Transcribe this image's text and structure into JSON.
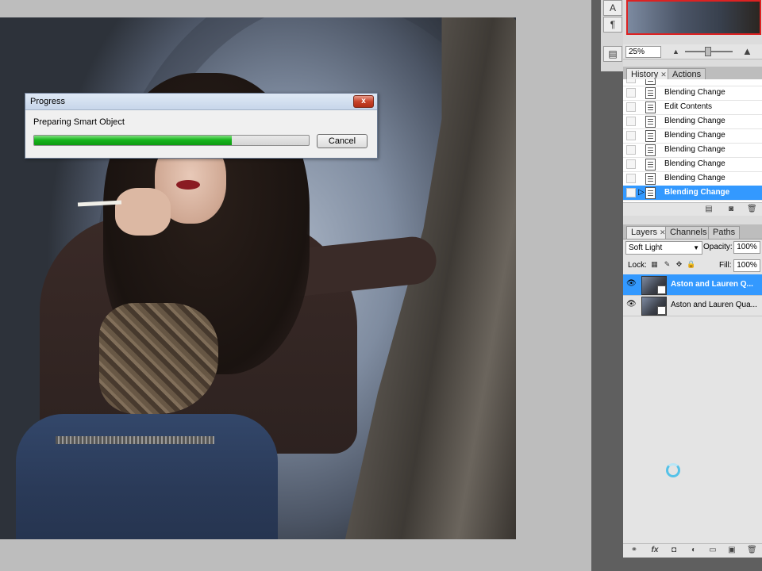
{
  "dialog": {
    "title": "Progress",
    "close_glyph": "x",
    "message": "Preparing Smart Object",
    "progress_fraction": 0.72,
    "cancel_label": "Cancel"
  },
  "toolstrip": {
    "icons": [
      "type-tool-icon",
      "paragraph-icon",
      "notes-icon"
    ],
    "glyph_type": "A",
    "glyph_paragraph": "¶",
    "glyph_notes": "▤"
  },
  "navigator": {
    "zoom": "25%"
  },
  "history_panel": {
    "tabs": [
      {
        "label": "History",
        "active": true,
        "closable": true
      },
      {
        "label": "Actions",
        "active": false
      }
    ],
    "items": [
      {
        "label": "Blending Change"
      },
      {
        "label": "Edit Contents"
      },
      {
        "label": "Blending Change"
      },
      {
        "label": "Blending Change"
      },
      {
        "label": "Blending Change"
      },
      {
        "label": "Blending Change"
      },
      {
        "label": "Blending Change"
      },
      {
        "label": "Blending Change",
        "selected": true
      }
    ],
    "footer_icons": [
      "new-document-from-state-icon",
      "new-snapshot-icon",
      "delete-state-icon"
    ]
  },
  "layers_panel": {
    "tabs": [
      {
        "label": "Layers",
        "active": true,
        "closable": true
      },
      {
        "label": "Channels",
        "active": false
      },
      {
        "label": "Paths",
        "active": false
      }
    ],
    "blend_mode": "Soft Light",
    "opacity_label": "Opacity:",
    "opacity": "100%",
    "lock_label": "Lock:",
    "fill_label": "Fill:",
    "fill": "100%",
    "layers": [
      {
        "name": "Aston and Lauren Q...",
        "selected": true,
        "visible": true
      },
      {
        "name": "Aston and Lauren Qua...",
        "selected": false,
        "visible": true
      }
    ],
    "footer_icons": [
      "link-layers-icon",
      "fx-icon",
      "add-mask-icon",
      "adjustment-layer-icon",
      "new-group-icon",
      "new-layer-icon",
      "delete-layer-icon"
    ],
    "fx_glyph": "fx"
  },
  "colors": {
    "selection": "#3399ff",
    "progress_green": "#18b51d",
    "close_red": "#c8432a",
    "busy_cyan": "#55c2e8"
  }
}
